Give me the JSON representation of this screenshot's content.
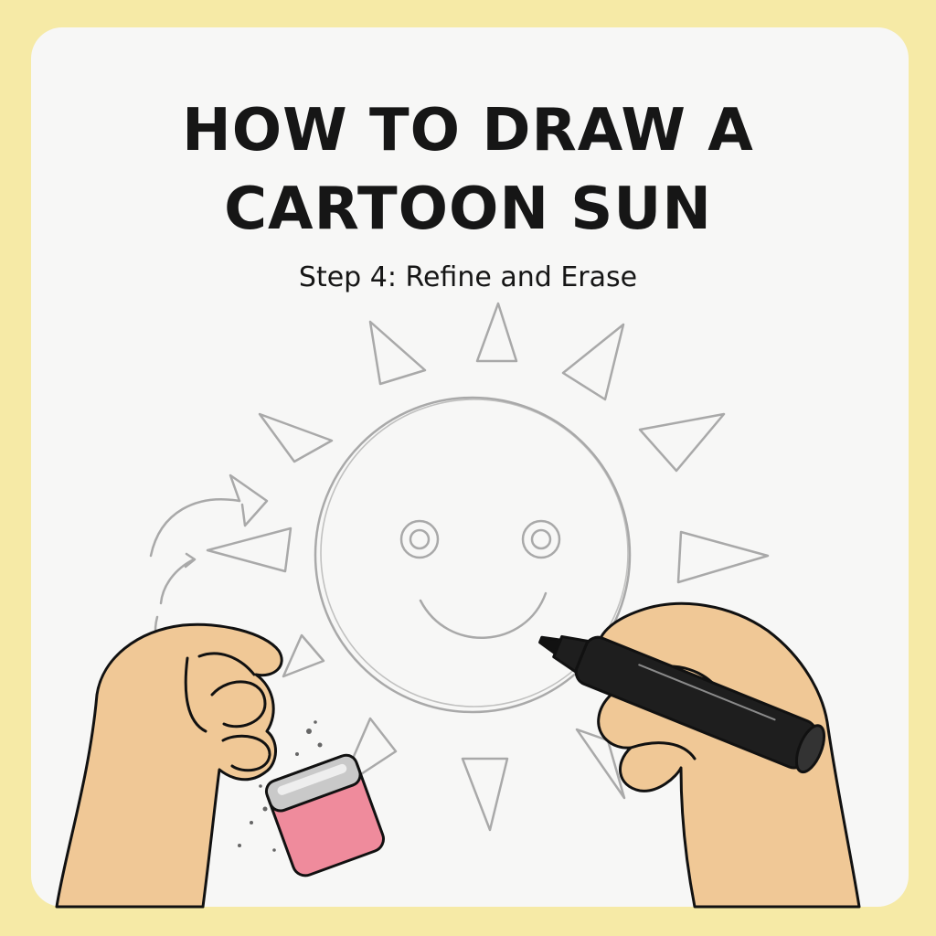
{
  "title": {
    "line1": "HOW TO DRAW A",
    "line2": "CARTOON SUN"
  },
  "subtitle": "Step 4: Refine and Erase",
  "colors": {
    "background": "#f6eaa6",
    "paper": "#f7f7f6",
    "pencil": "#a9a9a9",
    "skin": "#f0c896",
    "eraser": "#ef8b9c",
    "marker": "#1a1a1a"
  },
  "icons": {
    "sun": "sun-sketch-icon",
    "eraser": "eraser-icon",
    "marker": "marker-icon"
  }
}
